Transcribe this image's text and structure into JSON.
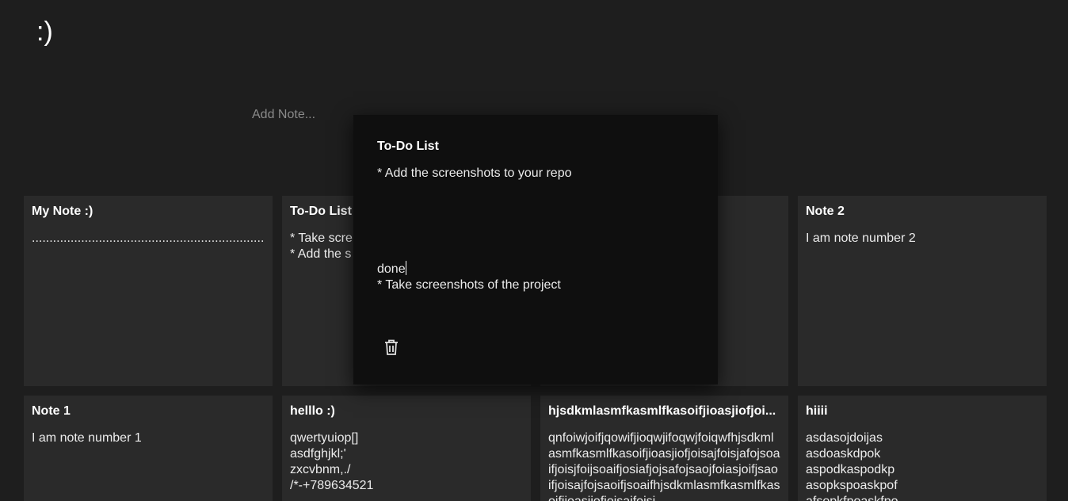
{
  "header": {
    "logo": ":)"
  },
  "add_note": {
    "placeholder": "Add Note..."
  },
  "notes": [
    {
      "title": "My Note :)",
      "body": "............................................................................................................................................................................................................................................................................................................................................................................................................................................................................................................................................................................................................................................................"
    },
    {
      "title": "To-Do List",
      "body": "* Take scre\n* Add the s"
    },
    {
      "title": "",
      "body": ""
    },
    {
      "title": "Note 2",
      "body": "I am note number 2"
    },
    {
      "title": "Note 1",
      "body": "I am note number 1"
    },
    {
      "title": "helllo :)",
      "body": "qwertyuiop[]\nasdfghjkl;'\nzxcvbnm,./\n/*-+789634521"
    },
    {
      "title": "hjsdkmlasmfkasmlfkasoifjioasjiofjoi...",
      "body": "qnfoiwjoifjqowifjioqwjifoqwjfoiqwfhjsdkmlasmfkasmlfkasoifjioasjiofjoisajfoisjafojsoaifjoisjfoijsoaifjosiafjojsafojsaojfoiasjoifjsaoifjoisajfojsaoifjsoaifhjsdkmlasmfkasmlfkasoifjioasjiofjoisajfoisj"
    },
    {
      "title": "hiiii",
      "body": "asdasojdoijas\nasdoaskdpok\naspodkaspodkp\nasopkspoaskpof\nafsopkfpoaskfpo"
    }
  ],
  "modal": {
    "title": "To-Do List",
    "body_before_caret": "* Add the screenshots to your repo\n\n\n\n\n\ndone",
    "body_after_caret": "\n* Take screenshots of the project",
    "delete_icon": "trash-icon"
  }
}
